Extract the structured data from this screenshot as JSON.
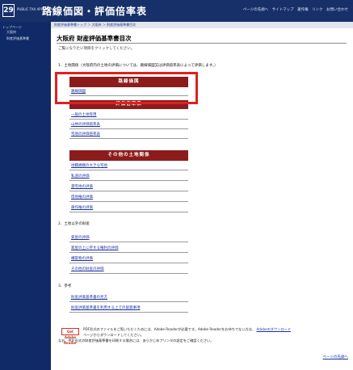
{
  "header": {
    "logo": "29",
    "brand_small": "PUBLIC TAX APPRAISAL",
    "title": "路線価図・評価倍率表",
    "links": [
      "ページの先頭へ",
      "サイトマップ",
      "著作権",
      "リンク",
      "お問い合わせ"
    ]
  },
  "sidebar": {
    "items": [
      "トップページ",
      "大阪府",
      "財産評価基準書"
    ]
  },
  "breadcrumb": "財産評価基準書トップ ＞ 大阪府 ＞ 財産評価基準書目次",
  "page_title": "大阪府 財産評価基準書目次",
  "intro": "ご覧になりたい項目をクリックしてください。",
  "sections": {
    "s1": "1．土地関係（大阪府内の土地の評価については、路線価図又は評価倍率表によって評価します。）",
    "s2": "2．土地以外の財産",
    "s3": "3．参考"
  },
  "group1": {
    "header": "路線価図",
    "link": "路線価図"
  },
  "group2": {
    "header": "評価倍率表",
    "links": [
      "一般の土地等用",
      "山林の評価倍率表",
      "宅地の評価倍率表"
    ]
  },
  "group3": {
    "header": "その他の土地関係",
    "links": [
      "地積規模の大きな宅地",
      "私道の評価",
      "貸宅地の評価",
      "借地権の評価",
      "耕作権の評価"
    ]
  },
  "group4": {
    "links": [
      "家屋の評価",
      "家屋の上に存する権利の評価",
      "構築物の評価",
      "その他の財産の評価"
    ]
  },
  "group5": {
    "links": [
      "財産評価基準書の見方",
      "財産評価基準書を利用する上での留意事項"
    ]
  },
  "notes": {
    "line1": "PDF形式のファイルをご覧いただくためには、Adobe Readerが必要です。Adobe Readerをお持ちでない方は、",
    "link": "Adobeのダウンロード",
    "line2": "ページからダウンロードしてください。",
    "line3": "なお、PDF形式の財産評価基準書を印刷する場合には、あらかじめプリンタの設定をご確認ください。",
    "adobe_badge": "Get Adobe Reader"
  },
  "back_to_top": "ページの先頭へ",
  "colors": {
    "header_bg": "#17306a",
    "sidebar_bg": "#0f2a66",
    "group_header": "#8c1c1c",
    "link": "#1b32a0",
    "highlight": "#e02020"
  }
}
